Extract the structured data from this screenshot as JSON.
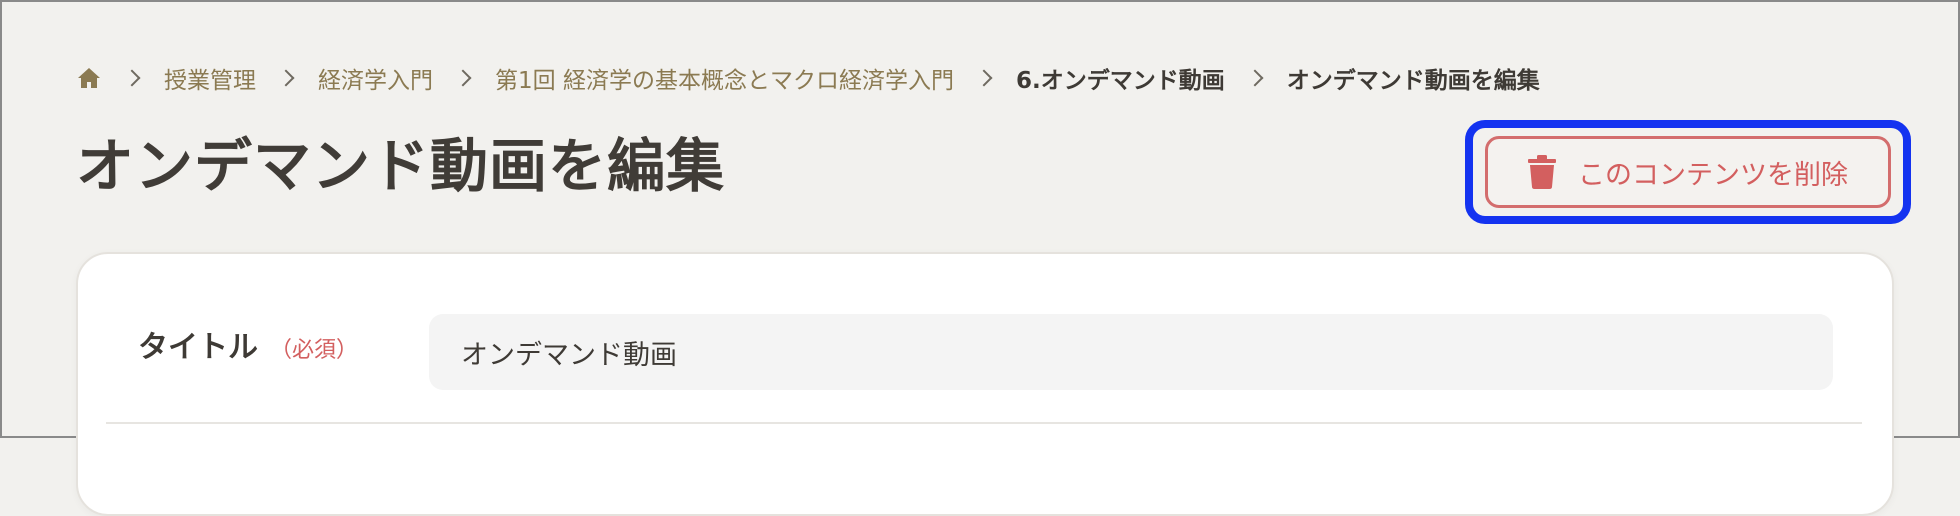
{
  "breadcrumb": {
    "home_icon": "home-icon",
    "items": [
      {
        "label": "授業管理"
      },
      {
        "label": "経済学入門"
      },
      {
        "label": "第1回 経済学の基本概念とマクロ経済学入門"
      },
      {
        "label": "6.オンデマンド動画"
      },
      {
        "label": "オンデマンド動画を編集"
      }
    ]
  },
  "page": {
    "title": "オンデマンド動画を編集"
  },
  "actions": {
    "delete_label": "このコンテンツを削除",
    "delete_icon": "trash-icon"
  },
  "form": {
    "title_label": "タイトル",
    "title_required": "（必須）",
    "title_value": "オンデマンド動画"
  },
  "colors": {
    "background": "#f2f1ee",
    "link": "#8b7a52",
    "danger": "#d35f5f",
    "focus": "#1433f0",
    "text": "#403c37"
  }
}
